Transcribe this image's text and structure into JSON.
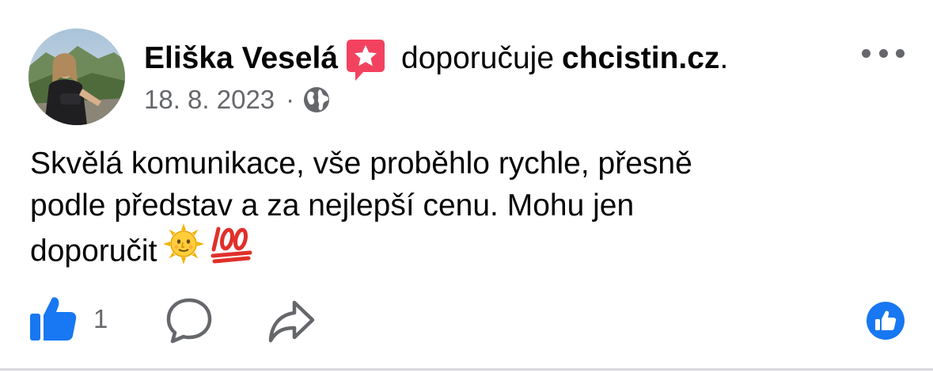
{
  "post": {
    "author": "Eliška Veselá",
    "recommends_text": "doporučuje",
    "page_name": "chcistin.cz",
    "period": ".",
    "date": "18. 8. 2023",
    "separator": "·",
    "audience_icon": "globe-icon",
    "recommendation_icon": "star-speech-bubble-icon",
    "more_icon": "more-dots-icon",
    "text_lines": [
      "Skvělá komunikace, vše proběhlo rychle, přesně",
      "podle představ a za nejlepší cenu. Mohu jen",
      "doporučit"
    ],
    "emojis": [
      "sun-with-face-emoji",
      "hundred-points-emoji"
    ]
  },
  "actions": {
    "like_count": "1",
    "like_icon": "thumbs-up-icon",
    "comment_icon": "comment-bubble-icon",
    "share_icon": "share-arrow-icon",
    "reaction_icon": "like-reaction-icon"
  },
  "colors": {
    "text_primary": "#050505",
    "text_secondary": "#65676b",
    "facebook_blue": "#1877f2",
    "recommend_red": "#f3425f",
    "divider": "#d7d9dc"
  }
}
